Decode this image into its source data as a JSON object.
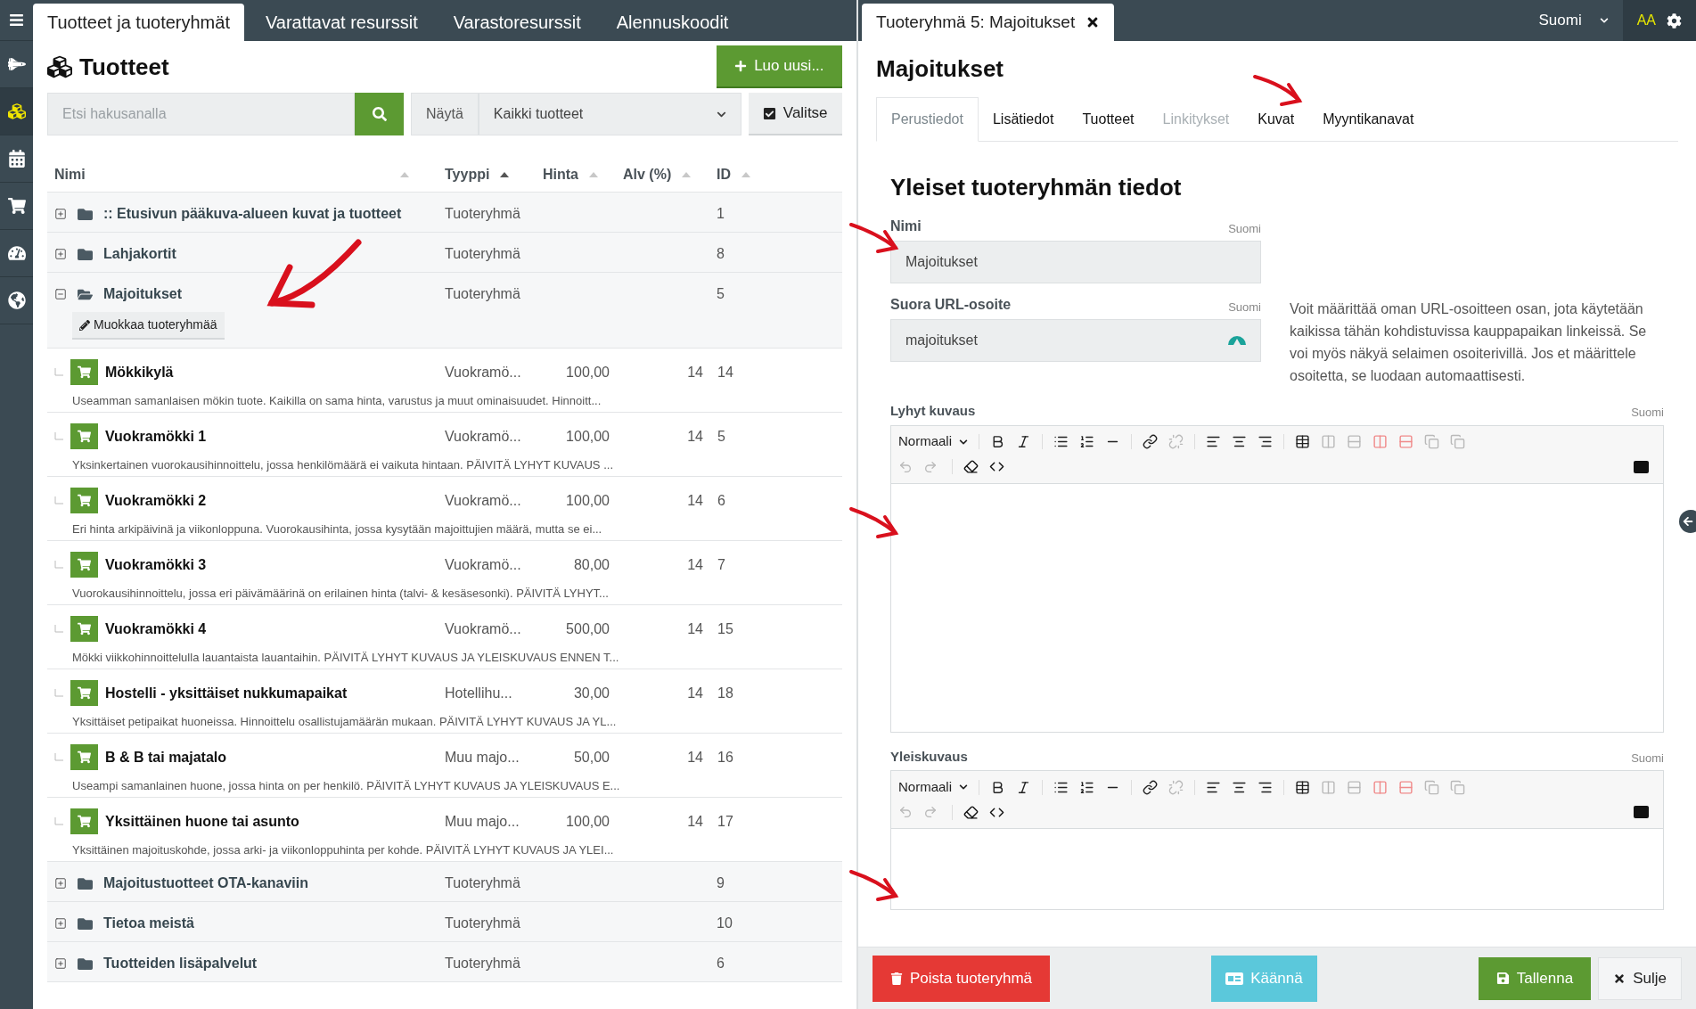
{
  "sidebar_items": [
    {
      "selected": false
    },
    {
      "selected": true
    },
    {
      "selected": false
    },
    {
      "selected": false
    },
    {
      "selected": false
    },
    {
      "selected": false
    }
  ],
  "left_tabs": [
    {
      "label": "Tuotteet ja tuoteryhmät",
      "selected": true
    },
    {
      "label": "Varattavat resurssit",
      "selected": false
    },
    {
      "label": "Varastoresurssit",
      "selected": false
    },
    {
      "label": "Alennuskoodit",
      "selected": false
    }
  ],
  "products_panel": {
    "title": "Tuotteet",
    "new_button": "Luo uusi...",
    "search": {
      "placeholder": "Etsi hakusanalla"
    },
    "filter_label": "Näytä",
    "filter_value": "Kaikki tuotteet",
    "select_button": {
      "label": "Valitse",
      "checked": true
    }
  },
  "table": {
    "columns": [
      {
        "label": "Nimi",
        "sorted": false
      },
      {
        "label": "Tyyppi",
        "sorted": true
      },
      {
        "label": "Hinta",
        "sorted": false
      },
      {
        "label": "Alv (%)",
        "sorted": false
      },
      {
        "label": "ID",
        "sorted": false
      }
    ],
    "rows": [
      {
        "kind": "group",
        "expanded": false,
        "name": ":: Etusivun pääkuva-alueen kuvat ja tuotteet",
        "type": "Tuoteryhmä",
        "id": "1"
      },
      {
        "kind": "group",
        "expanded": false,
        "name": "Lahjakortit",
        "type": "Tuoteryhmä",
        "id": "8"
      },
      {
        "kind": "group",
        "expanded": true,
        "name": "Majoitukset",
        "type": "Tuoteryhmä",
        "id": "5",
        "edit_button": "Muokkaa tuoteryhmää"
      },
      {
        "kind": "product",
        "name": "Mökkikylä",
        "type": "Vuokramö...",
        "price": "100,00",
        "vat": "14",
        "id": "14",
        "description": "Useamman samanlaisen mökin tuote. Kaikilla on sama hinta, varustus ja muut ominaisuudet. Hinnoitt..."
      },
      {
        "kind": "product",
        "name": "Vuokramökki 1",
        "type": "Vuokramö...",
        "price": "100,00",
        "vat": "14",
        "id": "5",
        "description": "Yksinkertainen vuorokausihinnoittelu, jossa henkilömäärä ei vaikuta hintaan. PÄIVITÄ LYHYT KUVAUS ..."
      },
      {
        "kind": "product",
        "name": "Vuokramökki 2",
        "type": "Vuokramö...",
        "price": "100,00",
        "vat": "14",
        "id": "6",
        "description": "Eri hinta arkipäivinä ja viikonloppuna. Vuorokausihinta, jossa kysytään majoittujien määrä, mutta se ei..."
      },
      {
        "kind": "product",
        "name": "Vuokramökki 3",
        "type": "Vuokramö...",
        "price": "80,00",
        "vat": "14",
        "id": "7",
        "description": "Vuorokausihinnoittelu, jossa eri päivämäärinä on erilainen hinta (talvi- & kesäsesonki). PÄIVITÄ LYHYT..."
      },
      {
        "kind": "product",
        "name": "Vuokramökki 4",
        "type": "Vuokramö...",
        "price": "500,00",
        "vat": "14",
        "id": "15",
        "description": "Mökki viikkohinnoittelulla lauantaista lauantaihin. PÄIVITÄ LYHYT KUVAUS JA YLEISKUVAUS ENNEN T..."
      },
      {
        "kind": "product",
        "name": "Hostelli - yksittäiset nukkumapaikat",
        "type": "Hotellihu...",
        "price": "30,00",
        "vat": "14",
        "id": "18",
        "description": "Yksittäiset petipaikat huoneissa. Hinnoittelu osallistujamäärän mukaan. PÄIVITÄ LYHYT KUVAUS JA YL..."
      },
      {
        "kind": "product",
        "name": "B & B tai majatalo",
        "type": "Muu majo...",
        "price": "50,00",
        "vat": "14",
        "id": "16",
        "description": "Useampi samanlainen huone, jossa hinta on per henkilö. PÄIVITÄ LYHYT KUVAUS JA YLEISKUVAUS E..."
      },
      {
        "kind": "product",
        "name": "Yksittäinen huone tai asunto",
        "type": "Muu majo...",
        "price": "100,00",
        "vat": "14",
        "id": "17",
        "description": "Yksittäinen majoituskohde, jossa arki- ja viikonloppuhinta per kohde. PÄIVITÄ LYHYT KUVAUS JA YLEI..."
      },
      {
        "kind": "group",
        "expanded": false,
        "name": "Majoitustuotteet OTA-kanaviin",
        "type": "Tuoteryhmä",
        "id": "9"
      },
      {
        "kind": "group",
        "expanded": false,
        "name": "Tietoa meistä",
        "type": "Tuoteryhmä",
        "id": "10"
      },
      {
        "kind": "group",
        "expanded": false,
        "name": "Tuotteiden lisäpalvelut",
        "type": "Tuoteryhmä",
        "id": "6"
      }
    ]
  },
  "editor_tab": {
    "title": "Tuoteryhmä 5: Majoitukset"
  },
  "language": "Suomi",
  "font_size_button": "AA",
  "detail": {
    "title": "Majoitukset",
    "tabs": [
      {
        "label": "Perustiedot",
        "selected": true,
        "disabled": false
      },
      {
        "label": "Lisätiedot",
        "selected": false,
        "disabled": false
      },
      {
        "label": "Tuotteet",
        "selected": false,
        "disabled": false
      },
      {
        "label": "Linkitykset",
        "selected": false,
        "disabled": true
      },
      {
        "label": "Kuvat",
        "selected": false,
        "disabled": false
      },
      {
        "label": "Myyntikanavat",
        "selected": false,
        "disabled": false
      }
    ],
    "section_title": "Yleiset tuoteryhmän tiedot",
    "fields": [
      {
        "label": "Nimi",
        "language": "Suomi",
        "value": "Majoitukset"
      },
      {
        "label": "Suora URL-osoite",
        "language": "Suomi",
        "value": "majoitukset",
        "help": "Voit määrittää oman URL-osoitteen osan, jota käytetään kaikissa tähän kohdistuvissa kauppapaikan linkeissä. Se voi myös näkyä selaimen osoiterivillä. Jos et määrittele osoitetta, se luodaan automaattisesti."
      }
    ],
    "editors": [
      {
        "label": "Lyhyt kuvaus",
        "language": "Suomi",
        "format": "Normaali"
      },
      {
        "label": "Yleiskuvaus",
        "language": "Suomi",
        "format": "Normaali"
      }
    ]
  },
  "actions": {
    "delete": "Poista tuoteryhmä",
    "translate": "Käännä",
    "save": "Tallenna",
    "close": "Sulje"
  }
}
